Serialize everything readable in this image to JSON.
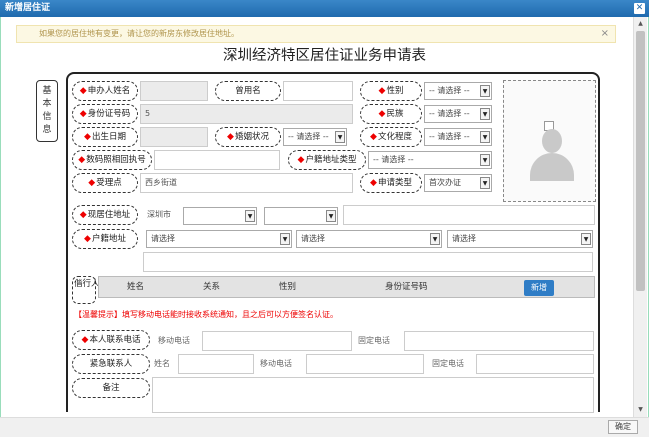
{
  "window": {
    "title": "新增居住证",
    "close": "✕",
    "ok_button": "确定"
  },
  "notice": {
    "text": "如果您的居住地有变更，请让您的新房东修改居住地址。",
    "close": "×"
  },
  "form_title": "深圳经济特区居住证业务申请表",
  "section_label": "基本信息",
  "fields": {
    "applicant_name": {
      "label": "申办人姓名",
      "value": ""
    },
    "former_name": {
      "label": "曾用名",
      "value": ""
    },
    "gender": {
      "label": "性别",
      "value": "-- 请选择 --"
    },
    "id_number": {
      "label": "身份证号码",
      "value": "5"
    },
    "ethnicity": {
      "label": "民族",
      "value": "-- 请选择 --"
    },
    "birth_date": {
      "label": "出生日期",
      "value": ""
    },
    "marital_status": {
      "label": "婚姻状况",
      "value": "-- 请选择 --"
    },
    "education": {
      "label": "文化程度",
      "value": "-- 请选择 --"
    },
    "photo_receipt": {
      "label": "数码照相回执号",
      "value": ""
    },
    "household_addr_type": {
      "label": "户籍地址类型",
      "value": "-- 请选择 --"
    },
    "accept_point": {
      "label": "受理点",
      "value": "西乡街道"
    },
    "apply_type": {
      "label": "申请类型",
      "value": "首次办证"
    },
    "current_addr": {
      "label": "现居住地址",
      "city": "深圳市"
    },
    "household_addr": {
      "label": "户籍地址",
      "sel1": "请选择",
      "sel2": "请选择",
      "sel3": "请选择"
    }
  },
  "cohabitants": {
    "label": "偕行人员",
    "columns": [
      "姓名",
      "关系",
      "性别",
      "身份证号码"
    ],
    "add_button": "新增"
  },
  "hint": "【温馨提示】填写移动电话能时接收系统通知，且之后可以方便签名认证。",
  "contact": {
    "label": "本人联系电话",
    "mobile": "移动电话",
    "landline": "固定电话"
  },
  "emergency": {
    "label": "紧急联系人",
    "name": "姓名",
    "mobile": "移动电话",
    "landline": "固定电话"
  },
  "remarks": {
    "label": "备注"
  }
}
